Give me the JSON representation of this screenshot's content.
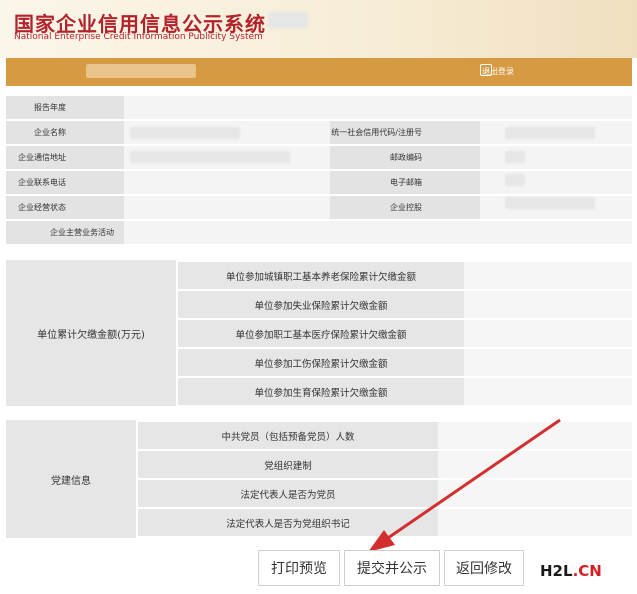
{
  "header": {
    "title": "国家企业信用信息公示系统",
    "subtitle": "National Enterprise Credit Information Publicity System"
  },
  "topbar": {
    "logout": "退出登录"
  },
  "basic_info": {
    "report_year": "报告年度",
    "company_name": "企业名称",
    "credit_code": "统一社会信用代码/注册号",
    "address": "企业通信地址",
    "postcode": "邮政编码",
    "phone": "企业联系电话",
    "email": "电子邮箱",
    "status": "企业经营状态",
    "shareholding": "企业控股",
    "main_business": "企业主营业务活动"
  },
  "arrears": {
    "group_label": "单位累计欠缴金额(万元)",
    "items": [
      "单位参加城镇职工基本养老保险累计欠缴金额",
      "单位参加失业保险累计欠缴金额",
      "单位参加职工基本医疗保险累计欠缴金额",
      "单位参加工伤保险累计欠缴金额",
      "单位参加生育保险累计欠缴金额"
    ]
  },
  "party": {
    "group_label": "党建信息",
    "items": [
      "中共党员（包括预备党员）人数",
      "党组织建制",
      "法定代表人是否为党员",
      "法定代表人是否为党组织书记"
    ]
  },
  "buttons": {
    "print": "打印预览",
    "submit": "提交并公示",
    "back": "返回修改"
  },
  "watermark": {
    "left": "H2L",
    "right": ".CN"
  },
  "colors": {
    "brand_red": "#b3232c",
    "bar": "#d69a42",
    "arrow": "#d32f2f"
  }
}
